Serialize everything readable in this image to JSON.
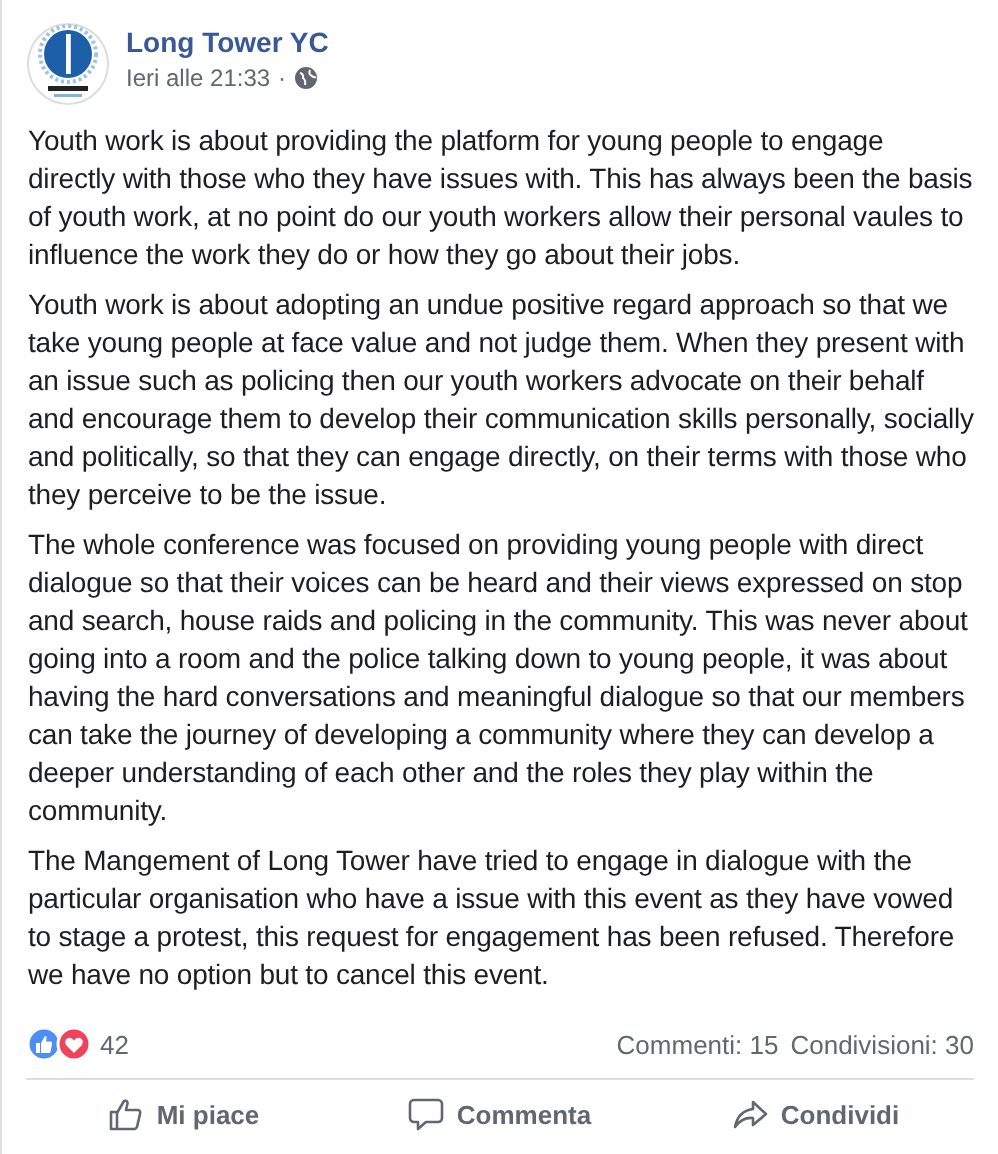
{
  "post": {
    "author": "Long Tower YC",
    "time": "Ieri alle 21:33",
    "separator": "·",
    "paragraphs": [
      "Youth work is about providing the platform for young people to engage directly with those who they have issues with. This has always been the basis of youth work, at no point do our youth workers allow their personal vaules to influence the work they do or how they go about their jobs.",
      "Youth work is about adopting an undue positive regard approach so that we take young people at face value and not judge them. When they present with an issue such as policing then our youth workers advocate on their behalf and encourage them to develop their communication skills personally, socially and politically, so that they can engage directly, on their terms with those who they perceive to be the issue.",
      "The whole conference was focused on providing young people with direct dialogue so that their voices can be heard and their views expressed on stop and search, house raids and policing in the community. This was never about going into a room and the police talking down to young people, it was about having the hard conversations and meaningful dialogue so that our members can take the journey of developing a community where they can develop a deeper understanding of each other and the roles they play within the community.",
      "The Mangement of Long Tower have tried to engage in dialogue with the particular organisation who have a issue with this event as they have vowed to stage a protest, this request for engagement has been refused. Therefore we have no option but to cancel this event."
    ],
    "reactions": {
      "count": "42",
      "comments": "Commenti: 15",
      "shares": "Condivisioni: 30"
    },
    "actions": [
      {
        "kind": "like",
        "label": "Mi piace"
      },
      {
        "kind": "comment",
        "label": "Commenta"
      },
      {
        "kind": "share",
        "label": "Condividi"
      }
    ]
  }
}
